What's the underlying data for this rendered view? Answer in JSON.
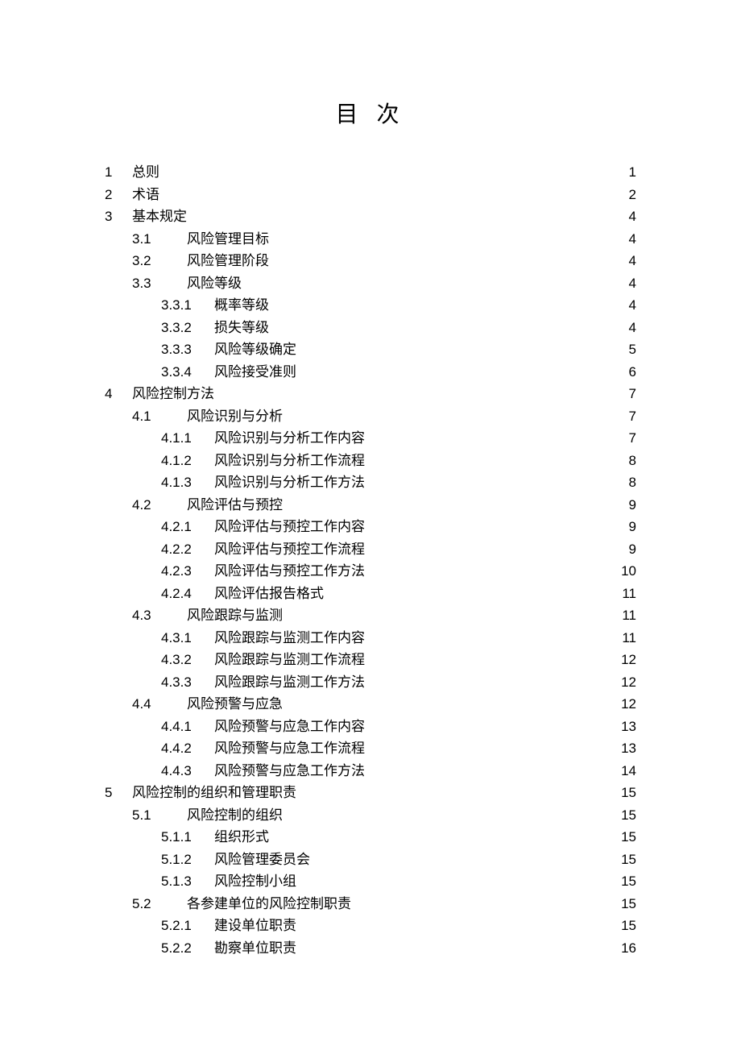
{
  "title": "目 次",
  "toc": [
    {
      "level": 1,
      "num": "1",
      "label": "总则",
      "page": "1"
    },
    {
      "level": 1,
      "num": "2",
      "label": "术语",
      "page": "2"
    },
    {
      "level": 1,
      "num": "3",
      "label": "基本规定",
      "page": "4"
    },
    {
      "level": 2,
      "num": "3.1",
      "label": "风险管理目标",
      "page": "4"
    },
    {
      "level": 2,
      "num": "3.2",
      "label": "风险管理阶段",
      "page": "4"
    },
    {
      "level": 2,
      "num": "3.3",
      "label": "风险等级",
      "page": "4"
    },
    {
      "level": 3,
      "num": "3.3.1",
      "label": "概率等级",
      "page": "4"
    },
    {
      "level": 3,
      "num": "3.3.2",
      "label": "损失等级",
      "page": "4"
    },
    {
      "level": 3,
      "num": "3.3.3",
      "label": "风险等级确定",
      "page": "5"
    },
    {
      "level": 3,
      "num": "3.3.4",
      "label": "风险接受准则",
      "page": "6"
    },
    {
      "level": 1,
      "num": "4",
      "label": "风险控制方法",
      "page": "7"
    },
    {
      "level": 2,
      "num": "4.1",
      "label": "风险识别与分析",
      "page": "7"
    },
    {
      "level": 3,
      "num": "4.1.1",
      "label": "风险识别与分析工作内容",
      "page": "7"
    },
    {
      "level": 3,
      "num": "4.1.2",
      "label": "风险识别与分析工作流程",
      "page": "8"
    },
    {
      "level": 3,
      "num": "4.1.3",
      "label": "风险识别与分析工作方法",
      "page": "8"
    },
    {
      "level": 2,
      "num": "4.2",
      "label": "风险评估与预控",
      "page": "9"
    },
    {
      "level": 3,
      "num": "4.2.1",
      "label": "风险评估与预控工作内容",
      "page": "9"
    },
    {
      "level": 3,
      "num": "4.2.2",
      "label": "风险评估与预控工作流程",
      "page": "9"
    },
    {
      "level": 3,
      "num": "4.2.3",
      "label": "风险评估与预控工作方法",
      "page": "10"
    },
    {
      "level": 3,
      "num": "4.2.4",
      "label": "风险评估报告格式",
      "page": "11"
    },
    {
      "level": 2,
      "num": "4.3",
      "label": "风险跟踪与监测",
      "page": "11"
    },
    {
      "level": 3,
      "num": "4.3.1",
      "label": "风险跟踪与监测工作内容",
      "page": "11"
    },
    {
      "level": 3,
      "num": "4.3.2",
      "label": "风险跟踪与监测工作流程",
      "page": "12"
    },
    {
      "level": 3,
      "num": "4.3.3",
      "label": "风险跟踪与监测工作方法",
      "page": "12"
    },
    {
      "level": 2,
      "num": "4.4",
      "label": "风险预警与应急",
      "page": "12"
    },
    {
      "level": 3,
      "num": "4.4.1",
      "label": "风险预警与应急工作内容",
      "page": "13"
    },
    {
      "level": 3,
      "num": "4.4.2",
      "label": "风险预警与应急工作流程",
      "page": "13"
    },
    {
      "level": 3,
      "num": "4.4.3",
      "label": "风险预警与应急工作方法",
      "page": "14"
    },
    {
      "level": 1,
      "num": "5",
      "label": "风险控制的组织和管理职责",
      "page": "15"
    },
    {
      "level": 2,
      "num": "5.1",
      "label": "风险控制的组织",
      "page": "15"
    },
    {
      "level": 3,
      "num": "5.1.1",
      "label": "组织形式",
      "page": "15"
    },
    {
      "level": 3,
      "num": "5.1.2",
      "label": "风险管理委员会",
      "page": "15"
    },
    {
      "level": 3,
      "num": "5.1.3",
      "label": "风险控制小组",
      "page": "15"
    },
    {
      "level": 2,
      "num": "5.2",
      "label": "各参建单位的风险控制职责",
      "page": "15"
    },
    {
      "level": 3,
      "num": "5.2.1",
      "label": "建设单位职责",
      "page": "15"
    },
    {
      "level": 3,
      "num": "5.2.2",
      "label": "勘察单位职责",
      "page": "16"
    }
  ]
}
